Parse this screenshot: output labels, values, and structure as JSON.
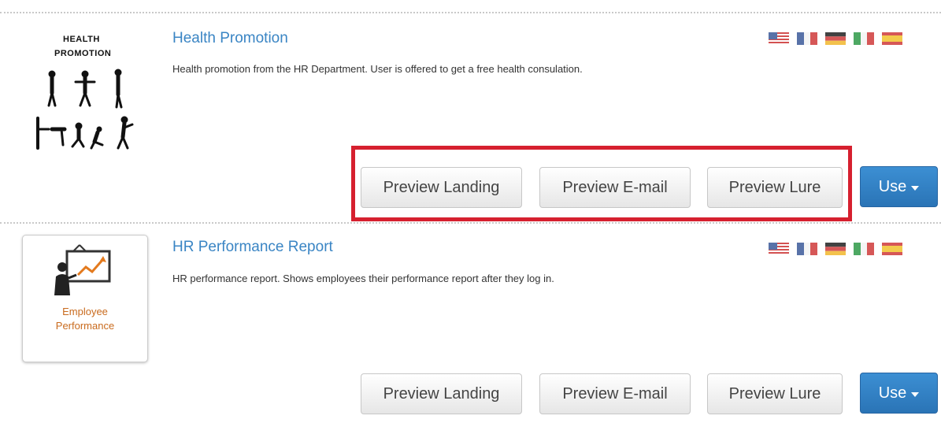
{
  "templates": [
    {
      "title": "Health Promotion",
      "description": "Health promotion from the HR Department. User is offered to get a free health consulation.",
      "thumbnail_text": [
        "HEALTH",
        "PROMOTION"
      ],
      "buttons": {
        "preview_landing": "Preview Landing",
        "preview_email": "Preview E-mail",
        "preview_lure": "Preview Lure",
        "use": "Use"
      }
    },
    {
      "title": "HR Performance Report",
      "description": "HR performance report. Shows employees their performance report after they log in.",
      "thumbnail_text": [
        "Employee",
        "Performance"
      ],
      "buttons": {
        "preview_landing": "Preview Landing",
        "preview_email": "Preview E-mail",
        "preview_lure": "Preview Lure",
        "use": "Use"
      }
    }
  ],
  "flags": [
    "us-flag-icon",
    "fr-flag-icon",
    "de-flag-icon",
    "it-flag-icon",
    "es-flag-icon"
  ],
  "colors": {
    "title": "#3a85c4",
    "use_button": "#2a74b6",
    "highlight": "#d6202f",
    "thumb_text": "#c96b1e"
  }
}
